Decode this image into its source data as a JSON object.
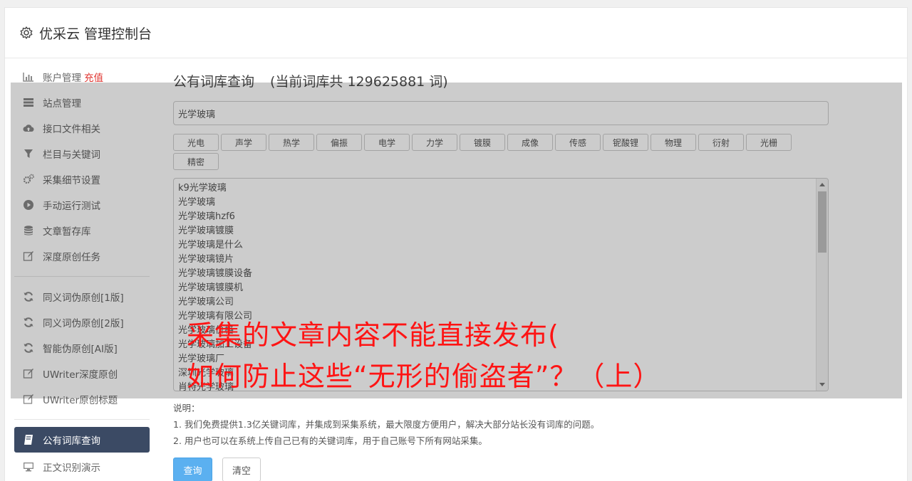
{
  "header": {
    "title": "优采云 管理控制台"
  },
  "sidebar": {
    "items": [
      {
        "label": "账户管理",
        "badge": "充值",
        "icon": "bar-chart-icon"
      },
      {
        "label": "站点管理",
        "icon": "list-icon"
      },
      {
        "label": "接口文件相关",
        "icon": "cloud-upload-icon"
      },
      {
        "label": "栏目与关键词",
        "icon": "filter-icon"
      },
      {
        "label": "采集细节设置",
        "icon": "gears-icon"
      },
      {
        "label": "手动运行测试",
        "icon": "play-circle-icon"
      },
      {
        "label": "文章暂存库",
        "icon": "database-icon"
      },
      {
        "label": "深度原创任务",
        "icon": "edit-icon"
      }
    ],
    "items2": [
      {
        "label": "同义词伪原创[1版]",
        "icon": "refresh-icon"
      },
      {
        "label": "同义词伪原创[2版]",
        "icon": "refresh-icon"
      },
      {
        "label": "智能伪原创[AI版]",
        "icon": "refresh-icon"
      },
      {
        "label": "UWriter深度原创",
        "icon": "edit-icon"
      },
      {
        "label": "UWriter原创标题",
        "icon": "edit-icon"
      }
    ],
    "items3": [
      {
        "label": "公有词库查询",
        "icon": "book-icon",
        "active": true
      },
      {
        "label": "正文识别演示",
        "icon": "monitor-icon"
      }
    ]
  },
  "main": {
    "title": "公有词库查询",
    "count_text": "(当前词库共 129625881 词)",
    "search_value": "光学玻璃",
    "tags": [
      "光电",
      "声学",
      "热学",
      "偏振",
      "电学",
      "力学",
      "镀膜",
      "成像",
      "传感",
      "铌酸锂",
      "物理",
      "衍射",
      "光栅",
      "精密"
    ],
    "keywords": [
      "k9光学玻璃",
      "光学玻璃",
      "光学玻璃hzf6",
      "光学玻璃镀膜",
      "光学玻璃是什么",
      "光学玻璃镜片",
      "光学玻璃镀膜设备",
      "光学玻璃镀膜机",
      "光学玻璃公司",
      "光学玻璃有限公司",
      "光学玻璃价格",
      "光学玻璃加工设备",
      "光学玻璃厂",
      "深圳光学玻璃",
      "肖特光学玻璃"
    ],
    "notes_title": "说明：",
    "notes": [
      "1. 我们免费提供1.3亿关键词库，并集成到采集系统，最大限度方便用户，解决大部分站长没有词库的问题。",
      "2. 用户也可以在系统上传自己已有的关键词库，用于自己账号下所有网站采集。"
    ],
    "query_button": "查询",
    "clear_button": "清空"
  },
  "overlay": {
    "line1": "采集的文章内容不能直接发布(",
    "line2": "如何防止这些“无形的偷盗者”？（上）",
    "color": "#ff1414"
  }
}
